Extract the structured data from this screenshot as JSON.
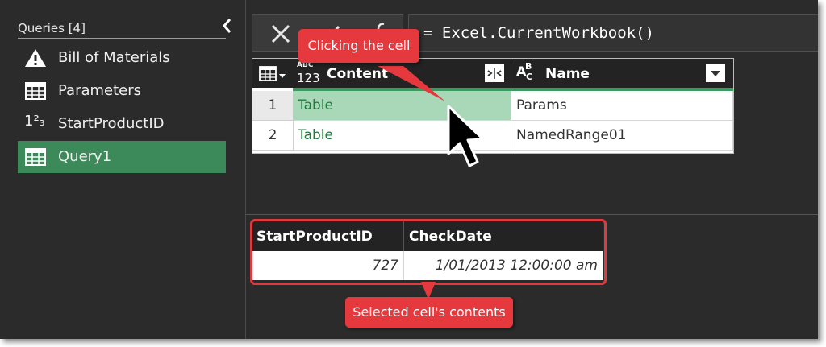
{
  "queries_pane": {
    "header": "Queries [4]",
    "items": [
      {
        "label": "Bill of Materials",
        "icon": "warning-icon",
        "selected": false
      },
      {
        "label": "Parameters",
        "icon": "table-icon",
        "selected": false
      },
      {
        "label": "StartProductID",
        "icon": "number-type-icon",
        "icon_text": "1²₃",
        "selected": false
      },
      {
        "label": "Query1",
        "icon": "table-icon",
        "selected": true
      }
    ]
  },
  "formula_bar": {
    "text": "= Excel.CurrentWorkbook()"
  },
  "grid": {
    "columns": [
      {
        "name": "Content",
        "type_icon": "any-type-icon",
        "type_text": "123"
      },
      {
        "name": "Name",
        "type_icon": "text-type-icon"
      }
    ],
    "rows": [
      {
        "num": "1",
        "content": "Table",
        "name": "Params"
      },
      {
        "num": "2",
        "content": "Table",
        "name": "NamedRange01"
      }
    ]
  },
  "preview": {
    "columns": [
      "StartProductID",
      "CheckDate"
    ],
    "values": [
      "727",
      "1/01/2013 12:00:00 am"
    ]
  },
  "annotations": {
    "top": "Clicking the cell",
    "bottom": "Selected cell's contents"
  },
  "colors": {
    "selected_query": "#3c8a5a",
    "callout": "#e5393e",
    "table_text": "#217a3f",
    "selected_cell": "#a9d8b8"
  }
}
